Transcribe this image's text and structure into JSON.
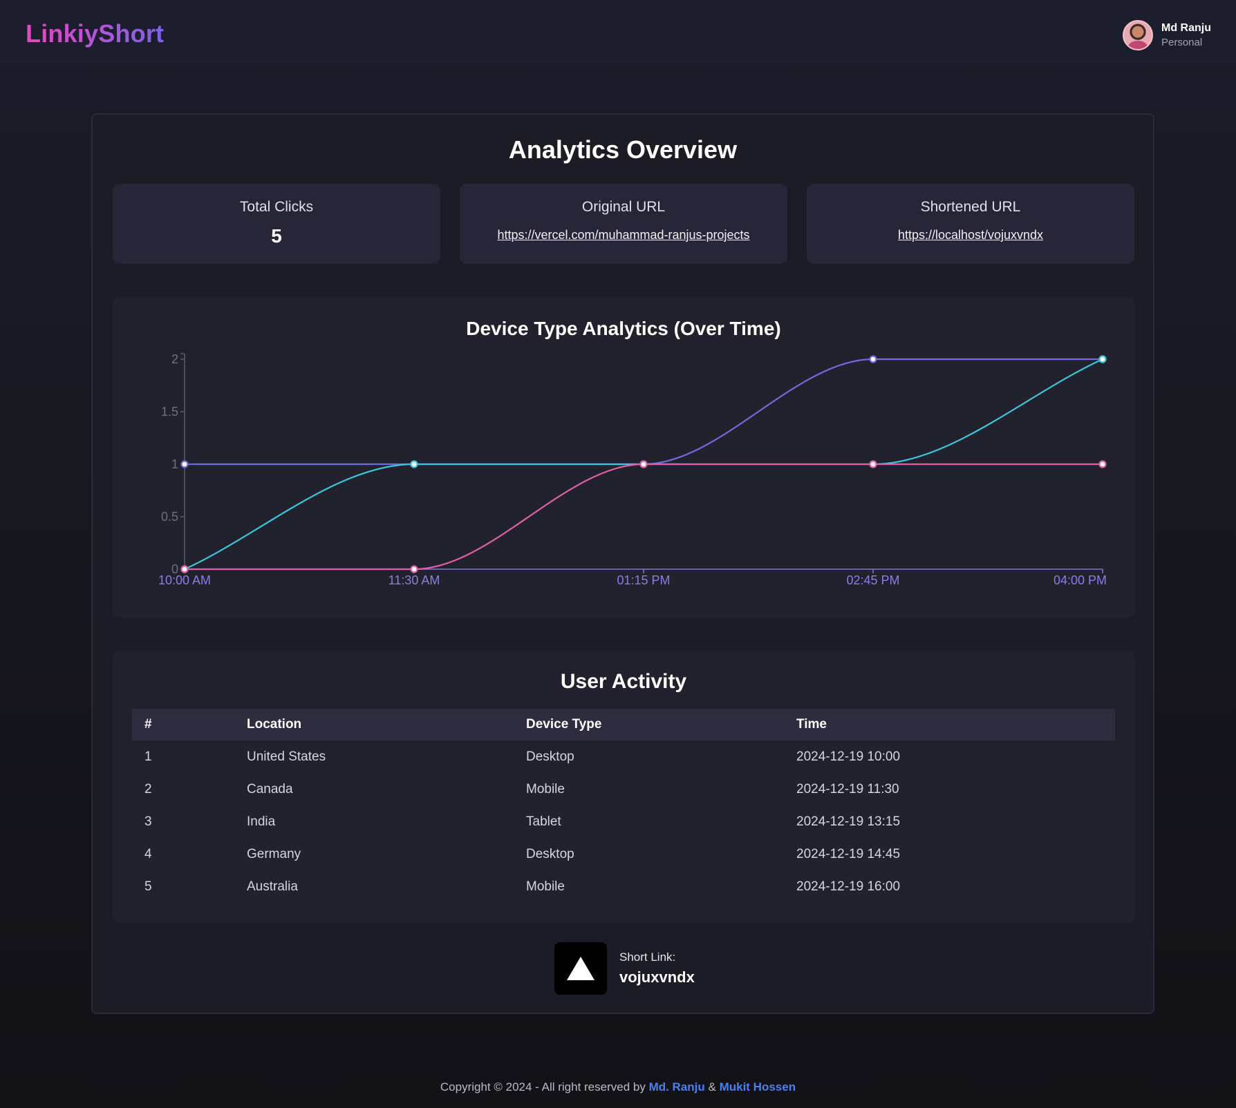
{
  "app": {
    "logo": "LinkiyShort"
  },
  "user": {
    "name": "Md Ranju",
    "role": "Personal"
  },
  "page": {
    "title": "Analytics Overview"
  },
  "stats": {
    "total_clicks_label": "Total Clicks",
    "total_clicks_value": "5",
    "original_url_label": "Original URL",
    "original_url": "https://vercel.com/muhammad-ranjus-projects",
    "shortened_url_label": "Shortened URL",
    "shortened_url": "https://localhost/vojuxvndx"
  },
  "chart_data": {
    "type": "line",
    "title": "Device Type Analytics (Over Time)",
    "categories": [
      "10:00 AM",
      "11:30 AM",
      "01:15 PM",
      "02:45 PM",
      "04:00 PM"
    ],
    "y_ticks": [
      "0",
      "0.5",
      "1",
      "1.5",
      "2"
    ],
    "ylim": [
      0,
      2
    ],
    "curve": "monotone",
    "grid": false,
    "legend": "none",
    "series": [
      {
        "color": "#6e6ae0",
        "values": [
          1,
          1,
          1,
          2,
          2
        ]
      },
      {
        "color": "#3cc6de",
        "values": [
          0,
          1,
          1,
          1,
          2
        ]
      },
      {
        "color": "#e060a8",
        "values": [
          0,
          0,
          1,
          1,
          1
        ]
      }
    ]
  },
  "activity": {
    "title": "User Activity",
    "columns": [
      "#",
      "Location",
      "Device Type",
      "Time"
    ],
    "rows": [
      [
        "1",
        "United States",
        "Desktop",
        "2024-12-19 10:00"
      ],
      [
        "2",
        "Canada",
        "Mobile",
        "2024-12-19 11:30"
      ],
      [
        "3",
        "India",
        "Tablet",
        "2024-12-19 13:15"
      ],
      [
        "4",
        "Germany",
        "Desktop",
        "2024-12-19 14:45"
      ],
      [
        "5",
        "Australia",
        "Mobile",
        "2024-12-19 16:00"
      ]
    ]
  },
  "shortlink": {
    "label": "Short Link:",
    "value": "vojuxvndx",
    "icon": "vercel-triangle-icon"
  },
  "footer": {
    "prefix": "Copyright © 2024 - All right reserved by ",
    "author1": "Md. Ranju",
    "amp": " & ",
    "author2": "Mukit Hossen"
  },
  "colors": {
    "logo_from": "#e04ab8",
    "logo_to": "#7c62e8",
    "link_accent": "#4d7ff0",
    "axis_text": "#8c7de6"
  }
}
